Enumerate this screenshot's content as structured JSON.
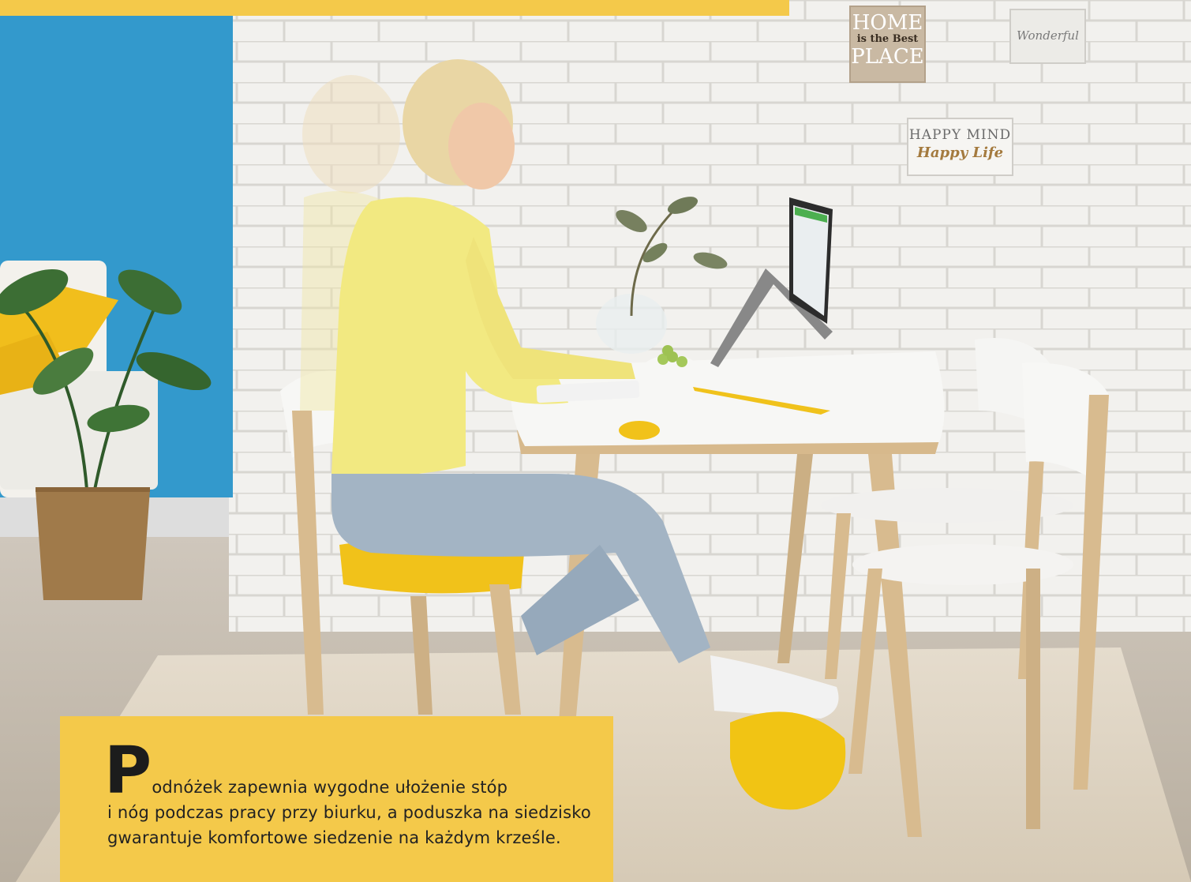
{
  "caption": {
    "dropcap": "P",
    "first_line": "odnóżek zapewnia wygodne ułożenie stóp",
    "rest": "i nóg podczas pracy przy biurku, a poduszka na siedzisko gwarantuje komfortowe siedzenie na każdym krześle."
  },
  "wall_signs": {
    "sign1_line1": "HOME",
    "sign1_line2": "is the Best",
    "sign1_line3": "PLACE",
    "sign2": "Wonderful",
    "sign3_line1": "HAPPY MIND",
    "sign3_line2": "Happy Life"
  },
  "colors": {
    "accent_yellow": "#f4c94a",
    "wall_blue": "#3399cc",
    "brick_white": "#f2f1ee",
    "floor": "#c9c1b6"
  }
}
